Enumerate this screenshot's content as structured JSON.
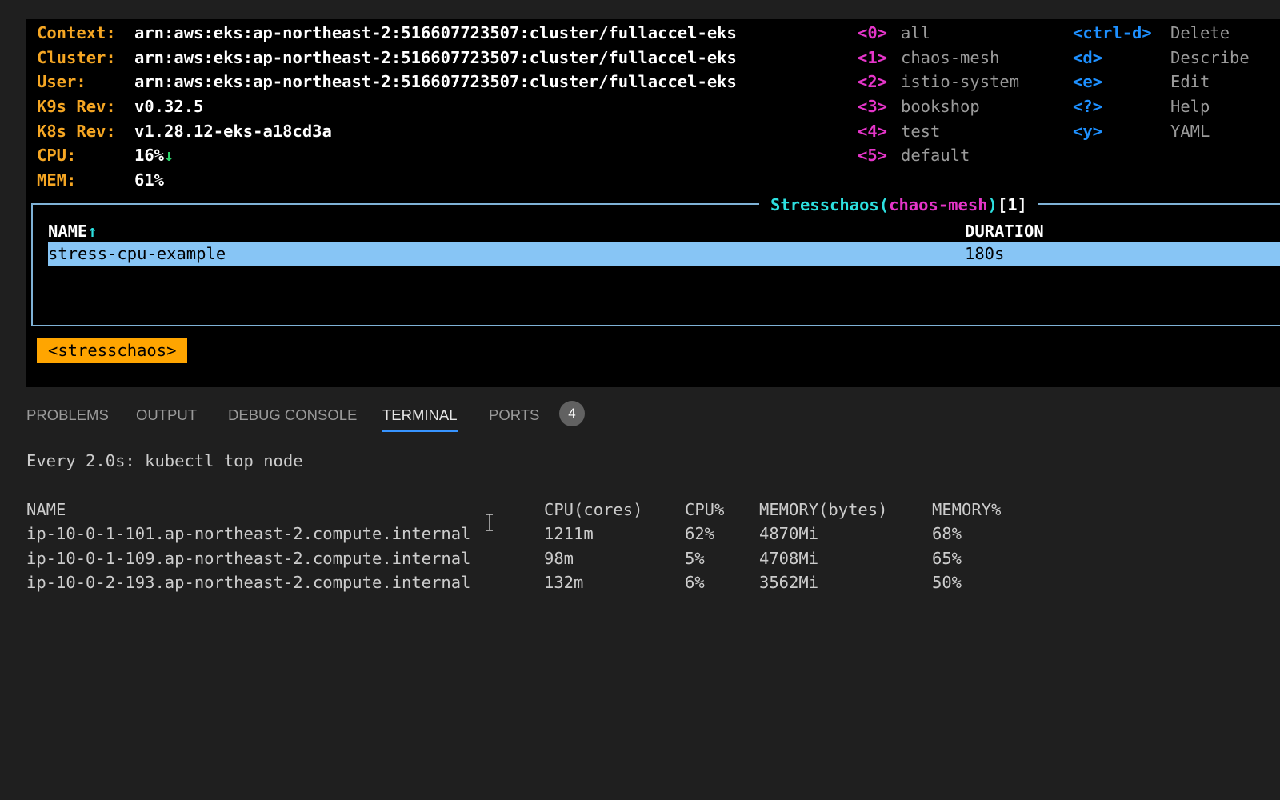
{
  "header": {
    "rows": [
      {
        "label": "Context:",
        "value": "arn:aws:eks:ap-northeast-2:516607723507:cluster/fullaccel-eks"
      },
      {
        "label": "Cluster:",
        "value": "arn:aws:eks:ap-northeast-2:516607723507:cluster/fullaccel-eks"
      },
      {
        "label": "User:",
        "value": "arn:aws:eks:ap-northeast-2:516607723507:cluster/fullaccel-eks"
      },
      {
        "label": "K9s Rev:",
        "value": "v0.32.5"
      },
      {
        "label": "K8s Rev:",
        "value": "v1.28.12-eks-a18cd3a"
      },
      {
        "label": "CPU:",
        "value": "16%",
        "trend": "↓"
      },
      {
        "label": "MEM:",
        "value": "61%"
      }
    ]
  },
  "namespaces": [
    {
      "key": "<0>",
      "name": "all"
    },
    {
      "key": "<1>",
      "name": "chaos-mesh"
    },
    {
      "key": "<2>",
      "name": "istio-system"
    },
    {
      "key": "<3>",
      "name": "bookshop"
    },
    {
      "key": "<4>",
      "name": "test"
    },
    {
      "key": "<5>",
      "name": "default"
    }
  ],
  "shortcuts": [
    {
      "key": "<ctrl-d>",
      "action": "Delete"
    },
    {
      "key": "<d>",
      "action": "Describe"
    },
    {
      "key": "<e>",
      "action": "Edit"
    },
    {
      "key": "<?>",
      "action": "Help"
    },
    {
      "key": "<y>",
      "action": "YAML"
    }
  ],
  "resource_view": {
    "title_kind": "Stresschaos",
    "title_open": "(",
    "title_namespace": "chaos-mesh",
    "title_close": ")",
    "title_count": "[1]",
    "columns": {
      "name": "NAME",
      "name_sort": "↑",
      "duration": "DURATION"
    },
    "rows": [
      {
        "name": "stress-cpu-example",
        "duration": "180s"
      }
    ],
    "breadcrumb": "<stresschaos>"
  },
  "panel": {
    "tabs": [
      "PROBLEMS",
      "OUTPUT",
      "DEBUG CONSOLE",
      "TERMINAL",
      "PORTS"
    ],
    "active_tab": "TERMINAL",
    "ports_count": "4"
  },
  "terminal": {
    "command_line": "Every 2.0s: kubectl top node",
    "headers": [
      "NAME",
      "CPU(cores)",
      "CPU%",
      "MEMORY(bytes)",
      "MEMORY%"
    ],
    "rows": [
      [
        "ip-10-0-1-101.ap-northeast-2.compute.internal",
        "1211m",
        "62%",
        "4870Mi",
        "68%"
      ],
      [
        "ip-10-0-1-109.ap-northeast-2.compute.internal",
        "98m",
        "5%",
        "4708Mi",
        "65%"
      ],
      [
        "ip-10-0-2-193.ap-northeast-2.compute.internal",
        "132m",
        "6%",
        "3562Mi",
        "50%"
      ]
    ]
  },
  "colors": {
    "label": "#f5a623",
    "namespace_key": "#e535c9",
    "shortcut_key": "#1e90ff",
    "title": "#2de0e0",
    "selection": "#87c5f5",
    "breadcrumb": "#ffa500",
    "active_tab_underline": "#3794ff"
  }
}
